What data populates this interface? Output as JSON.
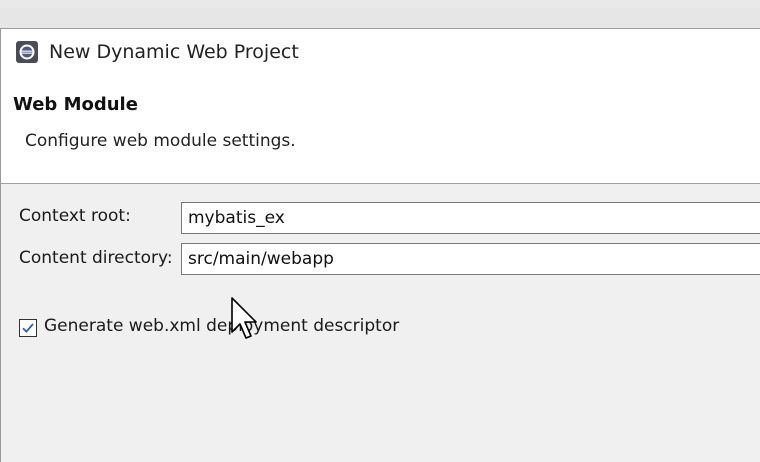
{
  "dialog": {
    "title": "New Dynamic Web Project",
    "banner_title": "Web Module",
    "banner_description": "Configure web module settings."
  },
  "form": {
    "context_root": {
      "label": "Context root:",
      "value": "mybatis_ex"
    },
    "content_directory": {
      "label": "Content directory:",
      "value": "src/main/webapp"
    },
    "generate_descriptor": {
      "label": "Generate web.xml deployment descriptor",
      "checked": true
    }
  },
  "colors": {
    "checkbox_mark": "#1f64c8",
    "banner_bg": "#ffffff",
    "dialog_bg": "#f0f0f0"
  }
}
